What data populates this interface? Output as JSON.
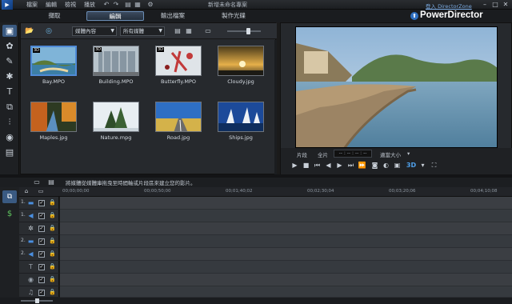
{
  "window": {
    "menu": [
      "檔案",
      "編輯",
      "檢視",
      "播放"
    ],
    "document_title": "新增未命名專案",
    "controls": [
      "–",
      "□",
      "✕"
    ]
  },
  "modes": {
    "tabs": [
      "擷取",
      "編輯",
      "輸出檔案",
      "製作光碟"
    ],
    "active_index": 1,
    "user_link": "登入 DirectorZone",
    "brand": "PowerDirector"
  },
  "library": {
    "filter_content": "媒體內容",
    "filter_media": "所有媒體",
    "items": [
      {
        "label": "Bay.MPO",
        "badge": "3D"
      },
      {
        "label": "Building.MPO",
        "badge": "3D"
      },
      {
        "label": "Butterfly.MPO",
        "badge": "3D"
      },
      {
        "label": "Cloudy.jpg",
        "badge": ""
      },
      {
        "label": "Maples.jpg",
        "badge": ""
      },
      {
        "label": "Nature.mpg",
        "badge": ""
      },
      {
        "label": "Road.jpg",
        "badge": ""
      },
      {
        "label": "Ships.jpg",
        "badge": ""
      }
    ]
  },
  "preview": {
    "clip_label": "片段",
    "movie_label": "全片",
    "timecode": "-- : -- : -- : --",
    "fit_label": "適當大小",
    "mode_3d": "3D"
  },
  "timeline": {
    "hint": "將媒體從媒體庫拖曳至時間軸或片段區來建立您的影片。",
    "ruler": [
      "00;00;00;00",
      "00;00;50;00",
      "00;01;40;02",
      "00;02;30;04",
      "00;03;20;06",
      "00;04;10;08"
    ],
    "tracks": [
      {
        "num": "1.",
        "icon": "video-track-icon",
        "glyph": "▬",
        "color": "#4a8fe0"
      },
      {
        "num": "1.",
        "icon": "audio-track-icon",
        "glyph": "◀",
        "color": "#4a8fe0"
      },
      {
        "num": "",
        "icon": "fx-track-icon",
        "glyph": "✲",
        "color": "#c9d0d8"
      },
      {
        "num": "2.",
        "icon": "video-track-icon",
        "glyph": "▬",
        "color": "#4a8fe0"
      },
      {
        "num": "2.",
        "icon": "audio-track-icon",
        "glyph": "◀",
        "color": "#4a8fe0"
      },
      {
        "num": "",
        "icon": "title-track-icon",
        "glyph": "T",
        "color": "#9aa3ad"
      },
      {
        "num": "",
        "icon": "voice-track-icon",
        "glyph": "🎙",
        "color": "#9aa3ad"
      },
      {
        "num": "",
        "icon": "music-track-icon",
        "glyph": "♫",
        "color": "#9aa3ad"
      }
    ]
  },
  "colors": {
    "accent": "#4f8ad6",
    "panel": "#26292d"
  }
}
